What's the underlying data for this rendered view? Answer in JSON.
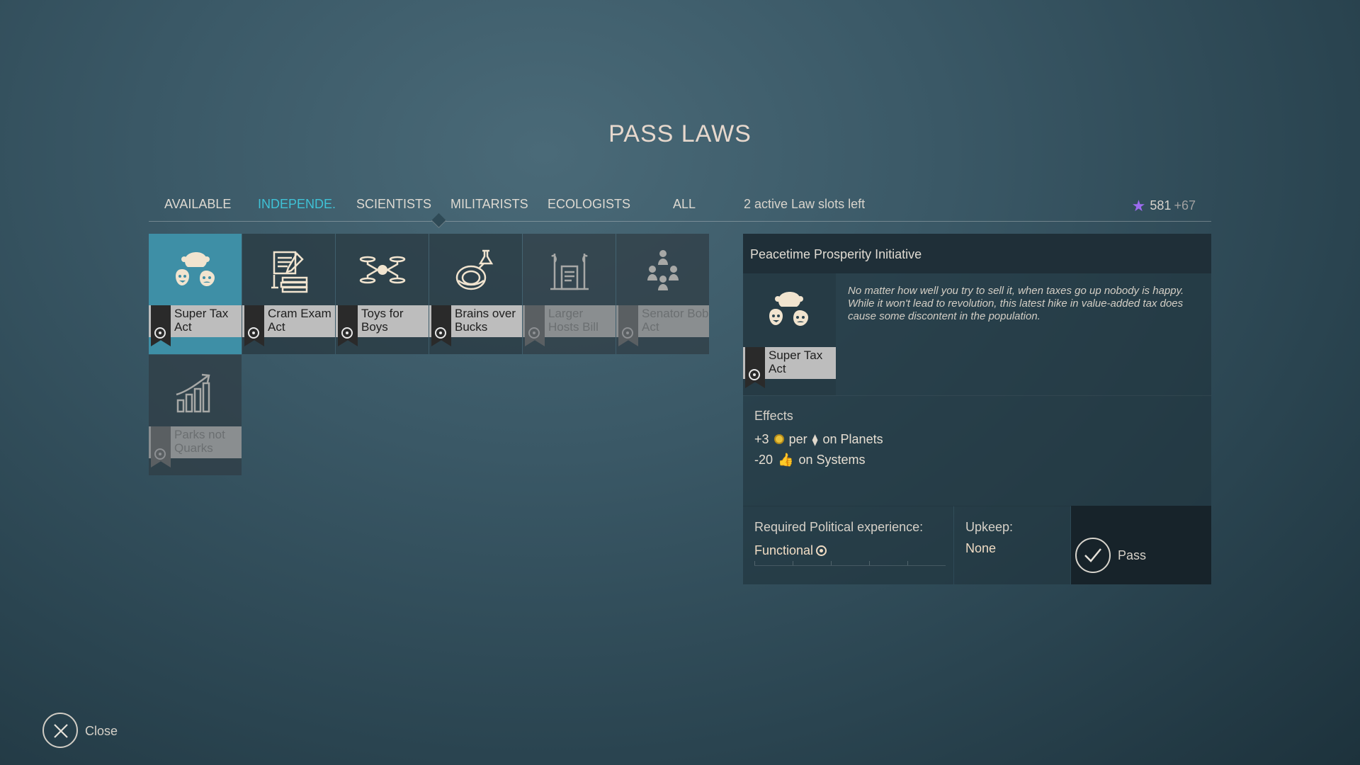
{
  "title": "PASS LAWS",
  "tabs": [
    {
      "label": "AVAILABLE",
      "active": false
    },
    {
      "label": "INDEPENDE.",
      "active": true
    },
    {
      "label": "SCIENTISTS",
      "active": false
    },
    {
      "label": "MILITARISTS",
      "active": false
    },
    {
      "label": "ECOLOGISTS",
      "active": false
    },
    {
      "label": "ALL",
      "active": false
    }
  ],
  "slots_text": "2 active Law slots left",
  "influence": {
    "value": "581",
    "gain": "+67",
    "icon": "star-icon",
    "color": "#9d6bf0"
  },
  "laws": [
    {
      "label": "Super Tax Act",
      "icon": "masks-icon",
      "state": "selected"
    },
    {
      "label": "Cram Exam Act",
      "icon": "exam-icon",
      "state": "available"
    },
    {
      "label": "Toys for Boys",
      "icon": "drone-icon",
      "state": "available"
    },
    {
      "label": "Brains over Bucks",
      "icon": "lab-icon",
      "state": "available"
    },
    {
      "label": "Larger Hosts Bill",
      "icon": "hosts-icon",
      "state": "locked"
    },
    {
      "label": "Senator Bob Act",
      "icon": "senator-icon",
      "state": "locked"
    },
    {
      "label": "Parks not Quarks",
      "icon": "growth-chart-icon",
      "state": "locked"
    }
  ],
  "detail": {
    "name": "Peacetime Prosperity Initiative",
    "law_label": "Super Tax Act",
    "flavor": "No matter how well you try to sell it, when taxes go up nobody is happy. While it won't lead to revolution, this latest hike in value-added tax does cause some discontent in the population.",
    "effects_title": "Effects",
    "effects": [
      {
        "prefix": "+3",
        "middle": "per",
        "suffix": "on Planets"
      },
      {
        "prefix": "-20",
        "suffix": "on Systems"
      }
    ],
    "requirement_label": "Required Political experience:",
    "requirement_value": "Functional",
    "upkeep_label": "Upkeep:",
    "upkeep_value": "None",
    "pass_label": "Pass"
  },
  "close_label": "Close"
}
